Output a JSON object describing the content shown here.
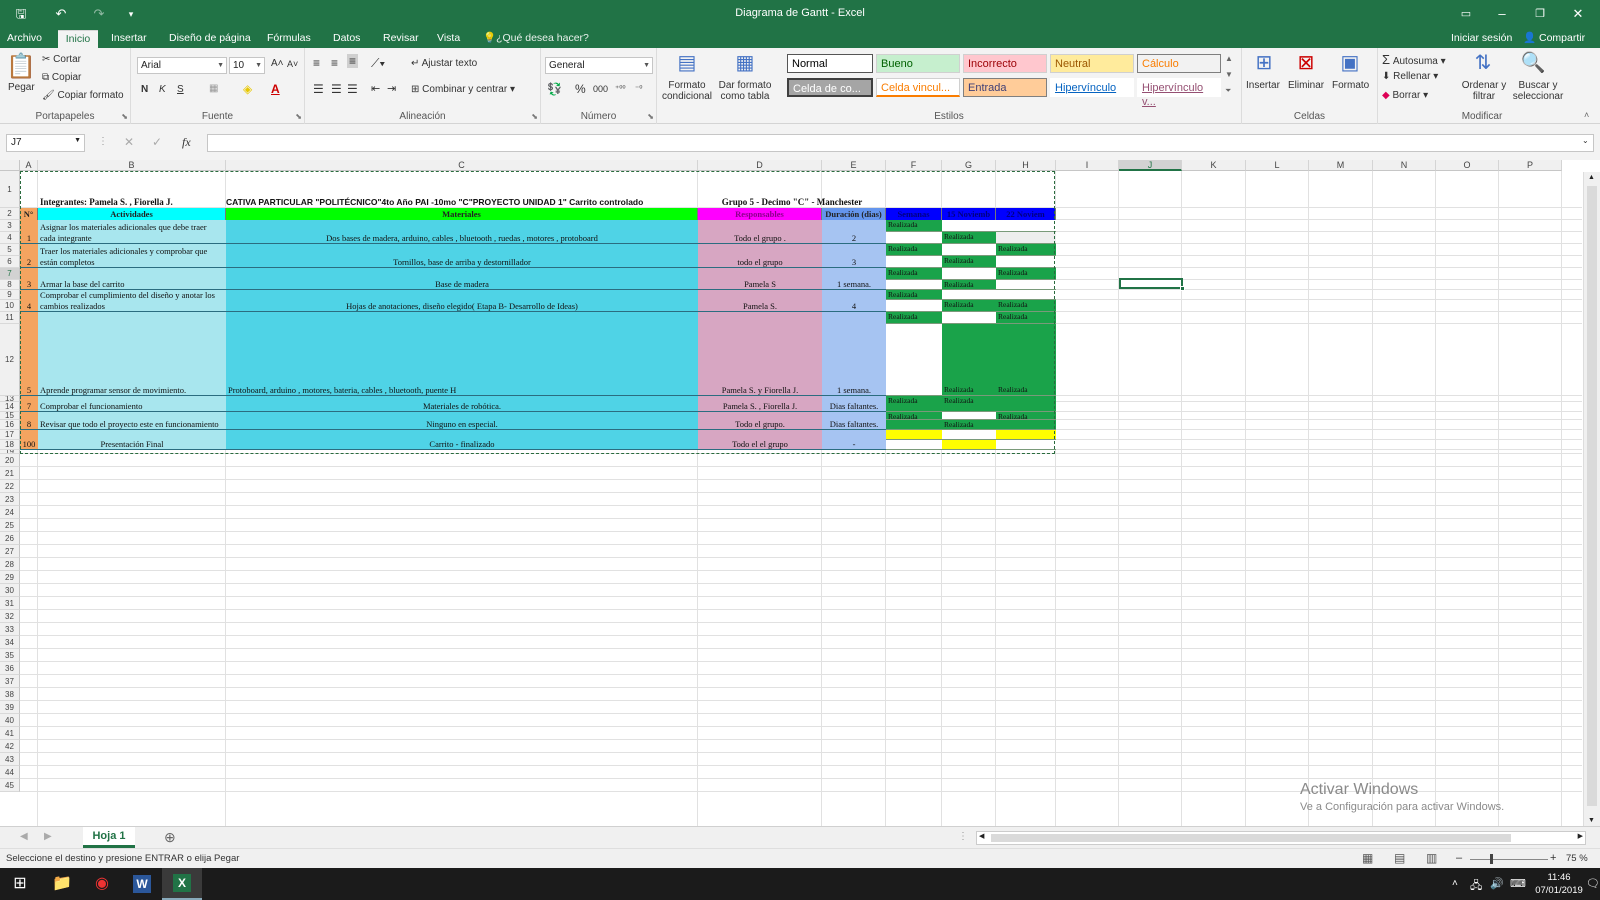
{
  "window": {
    "title": "Diagrama de Gantt - Excel"
  },
  "tabs": [
    {
      "label": "Archivo"
    },
    {
      "label": "Inicio"
    },
    {
      "label": "Insertar"
    },
    {
      "label": "Diseño de página"
    },
    {
      "label": "Fórmulas"
    },
    {
      "label": "Datos"
    },
    {
      "label": "Revisar"
    },
    {
      "label": "Vista"
    }
  ],
  "tell_me": "¿Qué desea hacer?",
  "signin": "Iniciar sesión",
  "share": "Compartir",
  "ribbon": {
    "clipboard": {
      "paste": "Pegar",
      "cut": "Cortar",
      "copy": "Copiar",
      "format_painter": "Copiar formato",
      "label": "Portapapeles"
    },
    "font": {
      "name": "Arial",
      "size": "10",
      "bold": "N",
      "italic": "K",
      "underline": "S",
      "label": "Fuente"
    },
    "alignment": {
      "wrap": "Ajustar texto",
      "merge": "Combinar y centrar",
      "label": "Alineación"
    },
    "number": {
      "format": "General",
      "label": "Número"
    },
    "styles": {
      "cond_format_1": "Formato",
      "cond_format_2": "condicional",
      "table_format_1": "Dar formato",
      "table_format_2": "como tabla",
      "items": [
        {
          "label": "Normal",
          "bg": "#ffffff",
          "fg": "#000000"
        },
        {
          "label": "Bueno",
          "bg": "#c6efce",
          "fg": "#006100"
        },
        {
          "label": "Incorrecto",
          "bg": "#ffc7ce",
          "fg": "#9c0006"
        },
        {
          "label": "Neutral",
          "bg": "#ffeb9c",
          "fg": "#9c5700"
        },
        {
          "label": "Cálculo",
          "bg": "#f2f2f2",
          "fg": "#fa7d00"
        },
        {
          "label": "Celda de co...",
          "bg": "#a5a5a5",
          "fg": "#ffffff"
        },
        {
          "label": "Celda vincul...",
          "bg": "#ffffff",
          "fg": "#fa7d00"
        },
        {
          "label": "Entrada",
          "bg": "#ffcc99",
          "fg": "#3f3f76"
        },
        {
          "label": "Hipervínculo",
          "bg": "#ffffff",
          "fg": "#0563c1"
        },
        {
          "label": "Hipervínculo v...",
          "bg": "#ffffff",
          "fg": "#954f72"
        }
      ],
      "label": "Estilos"
    },
    "cells": {
      "insert": "Insertar",
      "delete": "Eliminar",
      "format": "Formato",
      "label": "Celdas"
    },
    "editing": {
      "autosum": "Autosuma",
      "fill": "Rellenar",
      "clear": "Borrar",
      "sort_1": "Ordenar y",
      "sort_2": "filtrar",
      "find_1": "Buscar y",
      "find_2": "seleccionar",
      "label": "Modificar"
    }
  },
  "formula_bar": {
    "name_box": "J7",
    "fx": "fx",
    "value": ""
  },
  "columns": [
    "A",
    "B",
    "C",
    "D",
    "E",
    "F",
    "G",
    "H",
    "I",
    "J",
    "K",
    "L",
    "M",
    "N",
    "O",
    "P"
  ],
  "rows": [
    "1",
    "2",
    "3",
    "4",
    "5",
    "6",
    "7",
    "8",
    "9",
    "10",
    "11",
    "12",
    "13",
    "14",
    "15",
    "16",
    "17",
    "18",
    "19",
    "20",
    "21",
    "22",
    "23",
    "24",
    "25",
    "26",
    "27",
    "28",
    "29",
    "30",
    "31",
    "32",
    "33",
    "34",
    "35",
    "36",
    "37",
    "38",
    "39",
    "40",
    "41",
    "42",
    "43",
    "44",
    "45"
  ],
  "sheet": {
    "title_row": {
      "b": "Integrantes: Pamela S. , Fiorella J.",
      "c": "CATIVA PARTICULAR \"POLITÉCNICO\"4to Año PAI -10mo \"C\"PROYECTO UNIDAD 1\" Carrito controlado",
      "d": "Grupo 5 - Decimo \"C\" - Manchester"
    },
    "headers": {
      "a": "N°",
      "b": "Actividades",
      "c": "Materiales",
      "d": "Responsables",
      "e": "Duración (dias)",
      "f": "Semanas",
      "g": "15 Noviemb",
      "h": "22 Noviem"
    },
    "tasks": [
      {
        "n": "1",
        "activity": "Asignar los materiales adicionales que debe traer cada integrante",
        "materials": "Dos bases de madera, arduino, cables , bluetooth , ruedas , motores , protoboard",
        "resp": "Todo el grupo .",
        "dur": "2"
      },
      {
        "n": "2",
        "activity": "Traer los materiales adicionales y comprobar que están completos",
        "materials": "Tornillos, base de arriba y destornillador",
        "resp": "todo el grupo",
        "dur": "3"
      },
      {
        "n": "3",
        "activity": "Armar la base del carrito",
        "materials": "Base de madera",
        "resp": "Pamela S",
        "dur": "1 semana."
      },
      {
        "n": "4",
        "activity": "Comprobar el cumplimiento del diseño y anotar los cambios realizados",
        "materials": "Hojas de anotaciones,  diseño elegido( Etapa B- Desarrollo de Ideas)",
        "resp": "Pamela S.",
        "dur": "4"
      },
      {
        "n": "5",
        "activity": "Aprende programar sensor de movimiento.",
        "materials": "Protoboard, arduino , motores, bateria, cables , bluetooth, puente H",
        "resp": "Pamela S. y Fiorella J.",
        "dur": "1 semana."
      },
      {
        "n": "7",
        "activity": "Comprobar el funcionamiento",
        "materials": "Materiales de robótica.",
        "resp": "Pamela S. , Fiorella J.",
        "dur": "Dias faltantes."
      },
      {
        "n": "8",
        "activity": "Revisar que todo el proyecto este en funcionamiento",
        "materials": "Ninguno en especial.",
        "resp": "Todo el grupo.",
        "dur": "Dias faltantes."
      },
      {
        "n": "100",
        "activity": "Presentación Final",
        "materials": "Carrito - finalizado",
        "resp": "Todo el el grupo",
        "dur": "-"
      }
    ],
    "gantt_label": "Realizada"
  },
  "sheet_tab": "Hoja 1",
  "status": {
    "message": "Seleccione el destino y presione ENTRAR o elija Pegar",
    "zoom": "75 %"
  },
  "watermark": {
    "line1": "Activar Windows",
    "line2": "Ve a Configuración para activar Windows."
  },
  "taskbar": {
    "time": "11:46",
    "date": "07/01/2019"
  }
}
